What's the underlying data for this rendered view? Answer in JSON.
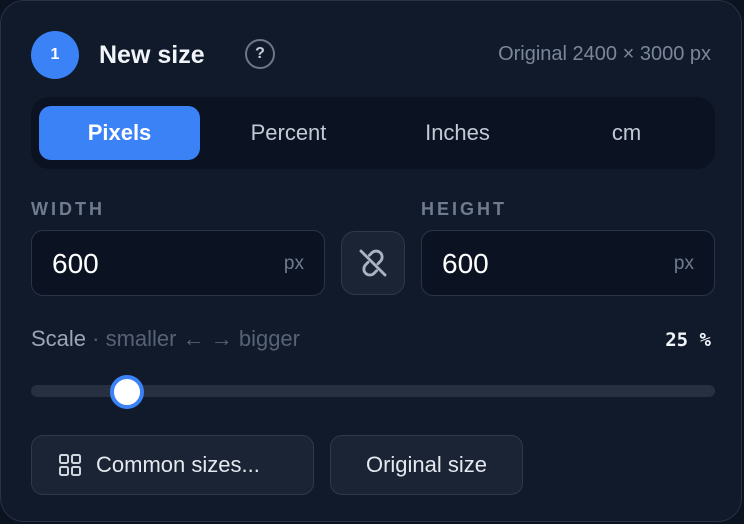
{
  "header": {
    "step_number": "1",
    "title": "New size",
    "help_label": "?",
    "original_info": "Original 2400 × 3000 px"
  },
  "unit_tabs": [
    {
      "label": "Pixels",
      "active": true
    },
    {
      "label": "Percent",
      "active": false
    },
    {
      "label": "Inches",
      "active": false
    },
    {
      "label": "cm",
      "active": false
    }
  ],
  "width": {
    "label": "WIDTH",
    "value": "600",
    "unit": "px"
  },
  "height": {
    "label": "HEIGHT",
    "value": "600",
    "unit": "px"
  },
  "link_toggle": {
    "icon": "link-off-icon",
    "linked": false
  },
  "scale": {
    "label": "Scale",
    "hint": " · smaller ← → bigger",
    "readout": "25 %",
    "value_fraction": 0.14
  },
  "buttons": {
    "common_sizes": "Common sizes...",
    "common_sizes_icon": "grid-icon",
    "original_size": "Original size"
  },
  "colors": {
    "accent": "#3b82f6",
    "panel_bg": "#111a2a",
    "page_bg": "#0b1220"
  }
}
